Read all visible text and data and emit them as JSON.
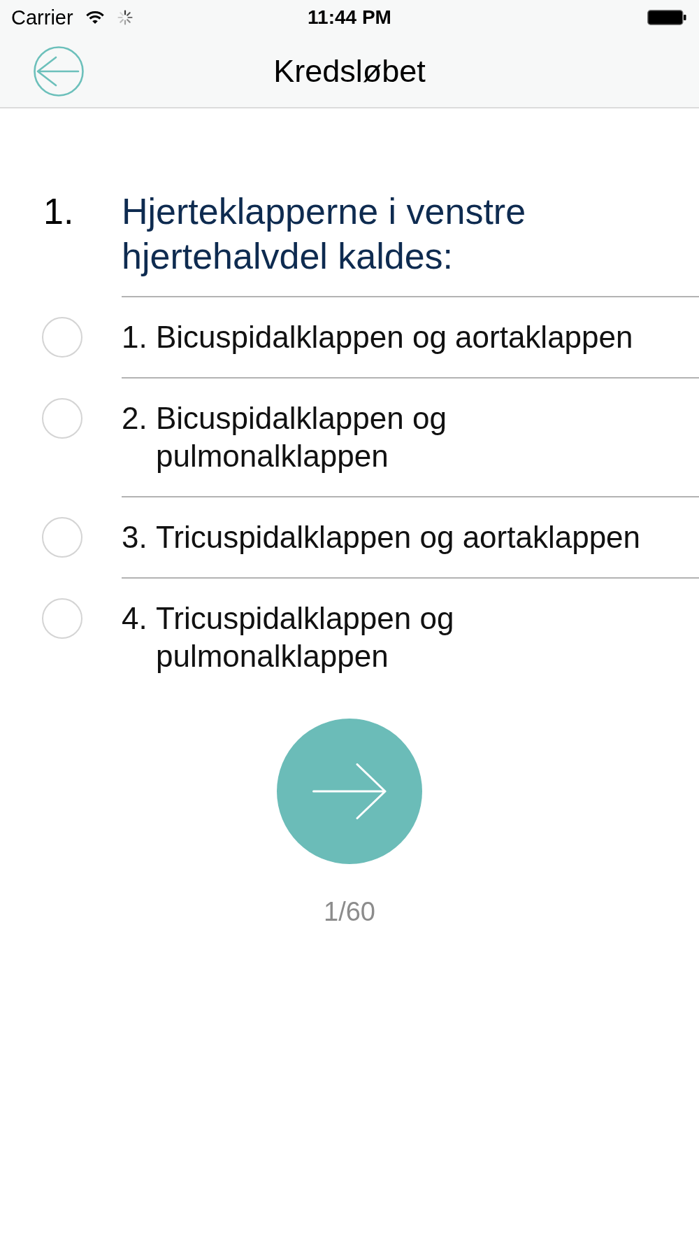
{
  "status_bar": {
    "carrier": "Carrier",
    "time": "11:44 PM"
  },
  "nav_bar": {
    "title": "Kredsløbet"
  },
  "question": {
    "number": "1.",
    "text": "Hjerteklapperne i venstre hjertehalvdel kaldes:"
  },
  "options": [
    {
      "number": "1.",
      "label": "Bicuspidalklappen og aortaklappen",
      "selected": false
    },
    {
      "number": "2.",
      "label": "Bicuspidalklappen og pulmonalklappen",
      "selected": false
    },
    {
      "number": "3.",
      "label": "Tricuspidalklappen og aortaklappen",
      "selected": false
    },
    {
      "number": "4.",
      "label": "Tricuspidalklappen og pulmonalklappen",
      "selected": false
    }
  ],
  "progress": "1/60"
}
